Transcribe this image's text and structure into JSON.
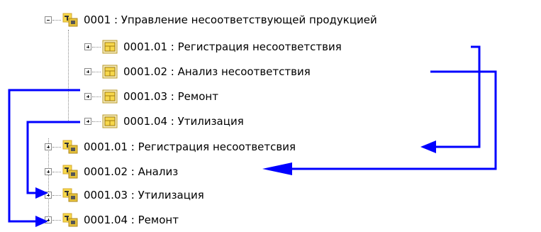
{
  "tree": {
    "root": {
      "label": "0001 : Управление несоответствующей продукцией",
      "children": [
        "0001.01 : Регистрация несоответствия",
        "0001.02 : Анализ несоответствия",
        "0001.03 : Ремонт",
        "0001.04 : Утилизация"
      ]
    },
    "reordered": [
      "0001.01 : Регистрация несоответсвия",
      "0001.02 : Анализ",
      "0001.03 : Утилизация",
      "0001.04 : Ремонт"
    ]
  },
  "colors": {
    "arrow": "#0000ff",
    "folder_yellow": "#f7d84a",
    "icon_frame": "#d4aa33",
    "tree_line": "#8a8a8a"
  },
  "icons": {
    "root": "process-icon",
    "children": "function-box-icon",
    "reordered": "process-icon"
  }
}
